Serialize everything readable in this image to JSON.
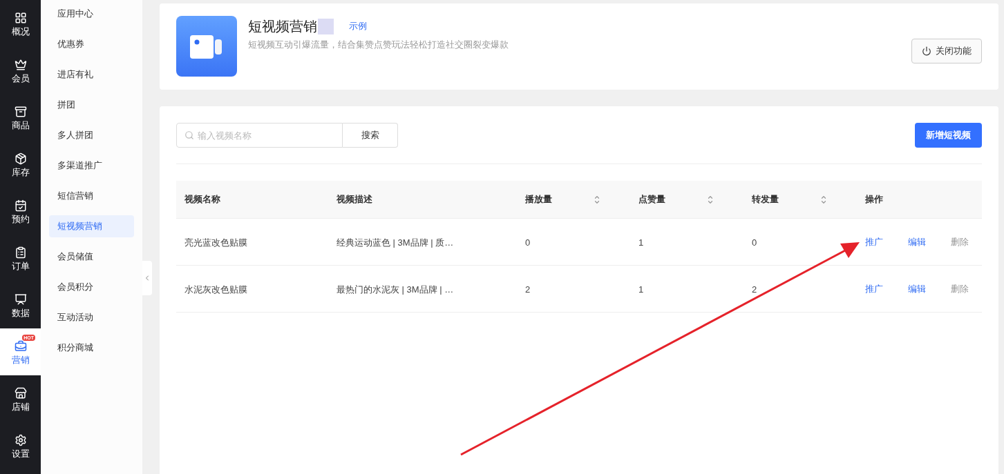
{
  "rail": [
    {
      "label": "概况",
      "selected": false
    },
    {
      "label": "会员",
      "selected": false
    },
    {
      "label": "商品",
      "selected": false
    },
    {
      "label": "库存",
      "selected": false
    },
    {
      "label": "预约",
      "selected": false
    },
    {
      "label": "订单",
      "selected": false
    },
    {
      "label": "数据",
      "selected": false
    },
    {
      "label": "营销",
      "selected": true,
      "badge": "HOT"
    },
    {
      "label": "店铺",
      "selected": false
    },
    {
      "label": "设置",
      "selected": false
    }
  ],
  "submenu": [
    {
      "label": "应用中心",
      "selected": false
    },
    {
      "label": "优惠券",
      "selected": false
    },
    {
      "label": "进店有礼",
      "selected": false
    },
    {
      "label": "拼团",
      "selected": false
    },
    {
      "label": "多人拼团",
      "selected": false
    },
    {
      "label": "多渠道推广",
      "selected": false
    },
    {
      "label": "短信营销",
      "selected": false
    },
    {
      "label": "短视频营销",
      "selected": true
    },
    {
      "label": "会员储值",
      "selected": false
    },
    {
      "label": "会员积分",
      "selected": false
    },
    {
      "label": "互动活动",
      "selected": false
    },
    {
      "label": "积分商城",
      "selected": false
    }
  ],
  "header": {
    "title": "短视频营销",
    "example_link": "示例",
    "description": "短视频互动引爆流量，结合集赞点赞玩法轻松打造社交圈裂变爆款",
    "close_button": "关闭功能"
  },
  "search": {
    "placeholder": "输入视频名称",
    "button": "搜索"
  },
  "add_button": "新增短视频",
  "table": {
    "columns": [
      {
        "label": "视频名称",
        "sortable": false
      },
      {
        "label": "视频描述",
        "sortable": false
      },
      {
        "label": "播放量",
        "sortable": true
      },
      {
        "label": "点赞量",
        "sortable": true
      },
      {
        "label": "转发量",
        "sortable": true
      },
      {
        "label": "操作",
        "sortable": false
      }
    ],
    "rows": [
      {
        "cells": [
          "亮光蓝改色贴膜",
          "经典运动蓝色 | 3M品牌 | 质…",
          "0",
          "1",
          "0"
        ],
        "actions": [
          {
            "label": "推广",
            "muted": false
          },
          {
            "label": "编辑",
            "muted": false
          },
          {
            "label": "删除",
            "muted": true
          }
        ]
      },
      {
        "cells": [
          "水泥灰改色贴膜",
          "最热门的水泥灰 | 3M品牌 | …",
          "2",
          "1",
          "2"
        ],
        "actions": [
          {
            "label": "推广",
            "muted": false
          },
          {
            "label": "编辑",
            "muted": false
          },
          {
            "label": "删除",
            "muted": true
          }
        ]
      }
    ]
  }
}
